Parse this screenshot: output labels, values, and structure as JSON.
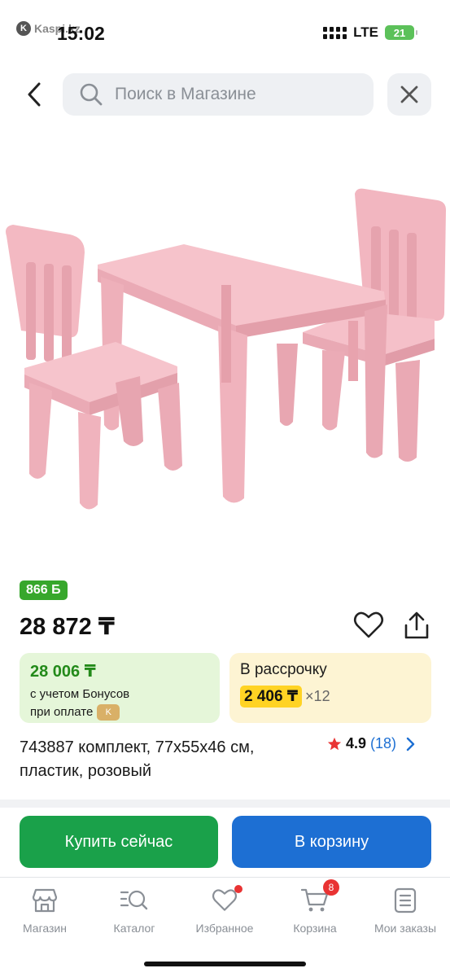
{
  "status_bar": {
    "app_name": "Kaspi.kz",
    "time": "15:02",
    "network": "LTE",
    "battery": "21"
  },
  "search": {
    "placeholder": "Поиск в Магазине"
  },
  "product": {
    "bonus_badge": "866 Б",
    "price": "28 872 ₸",
    "bonus_price": "28 006 ₸",
    "bonus_note_line1": "с учетом Бонусов",
    "bonus_note_line2": "при оплате",
    "installment_label": "В рассрочку",
    "installment_monthly": "2 406 ₸",
    "installment_months": "×12",
    "title": "743887 комплект, 77х55х46 см, пластик, розовый",
    "rating": "4.9",
    "reviews": "(18)"
  },
  "actions": {
    "buy_now": "Купить сейчас",
    "add_to_cart": "В корзину"
  },
  "nav": {
    "items": [
      {
        "label": "Магазин",
        "icon": "store-icon"
      },
      {
        "label": "Каталог",
        "icon": "catalog-search-icon"
      },
      {
        "label": "Избранное",
        "icon": "heart-icon"
      },
      {
        "label": "Корзина",
        "icon": "cart-icon",
        "badge": "8"
      },
      {
        "label": "Мои заказы",
        "icon": "orders-icon"
      }
    ]
  },
  "colors": {
    "accent_blue": "#1d6fd3",
    "buy_green": "#1aa14a",
    "bonus_green": "#37a72c",
    "installment_yellow": "#ffd324",
    "badge_red": "#e93333",
    "product_pink": "#f4b9c2"
  }
}
